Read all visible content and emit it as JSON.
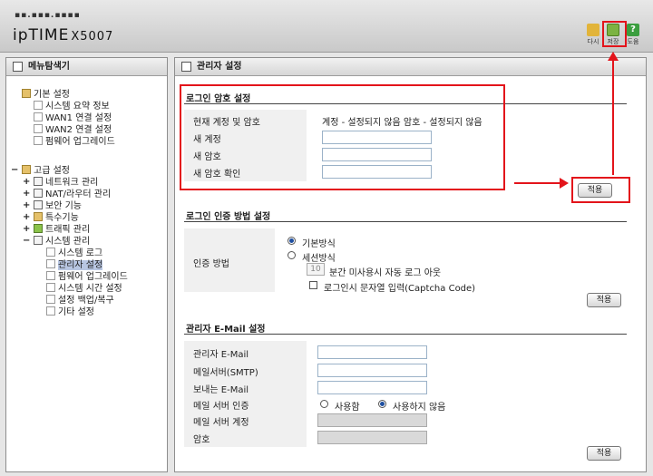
{
  "header": {
    "brand_dots": "▪▪.▪▪▪.▪▪▪▪",
    "brand": "ipTIME",
    "model": "X5007",
    "buttons": [
      {
        "label": "다시",
        "icon": "restart-icon"
      },
      {
        "label": "저장",
        "icon": "save-icon"
      },
      {
        "label": "도움",
        "icon": "help-icon"
      }
    ]
  },
  "left": {
    "title": "메뉴탐색기",
    "basic": {
      "label": "기본 설정",
      "items": [
        "시스템 요약 정보",
        "WAN1 연결 설정",
        "WAN2 연결 설정",
        "펌웨어 업그레이드"
      ]
    },
    "advanced": {
      "label": "고급 설정",
      "items": [
        "네트워크 관리",
        "NAT/라우터 관리",
        "보안 기능",
        "특수기능",
        "트래픽 관리",
        "시스템 관리"
      ],
      "system_items": [
        "시스템 로그",
        "관리자 설정",
        "펌웨어 업그레이드",
        "시스템 시간 설정",
        "설정 백업/복구",
        "기타 설정"
      ]
    }
  },
  "main": {
    "title": "관리자 설정",
    "login_pw": {
      "title": "로그인 암호 설정",
      "current_label": "현재 계정 및 암호",
      "current_value": "계정 - 설정되지 않음   암호 - 설정되지 않음",
      "new_account": "새 계정",
      "new_password": "새 암호",
      "confirm_password": "새 암호 확인",
      "apply": "적용"
    },
    "auth": {
      "title": "로그인 인증 방법 설정",
      "method_label": "인증 방법",
      "basic": "기본방식",
      "session": "세션방식",
      "timeout_value": "10",
      "timeout_label": "분간 미사용시 자동 로그 아웃",
      "captcha": "로그인시 문자열 입력(Captcha Code)",
      "apply": "적용"
    },
    "email": {
      "title": "관리자 E-Mail 설정",
      "admin_email": "관리자 E-Mail",
      "smtp": "메일서버(SMTP)",
      "sender": "보내는 E-Mail",
      "server_auth": "메일 서버 인증",
      "use": "사용함",
      "not_use": "사용하지 않음",
      "server_account": "메일 서버 계정",
      "password": "암호",
      "apply": "적용"
    }
  },
  "colors": {
    "accent": "#e3141b",
    "selected": "#b8c6e2"
  }
}
